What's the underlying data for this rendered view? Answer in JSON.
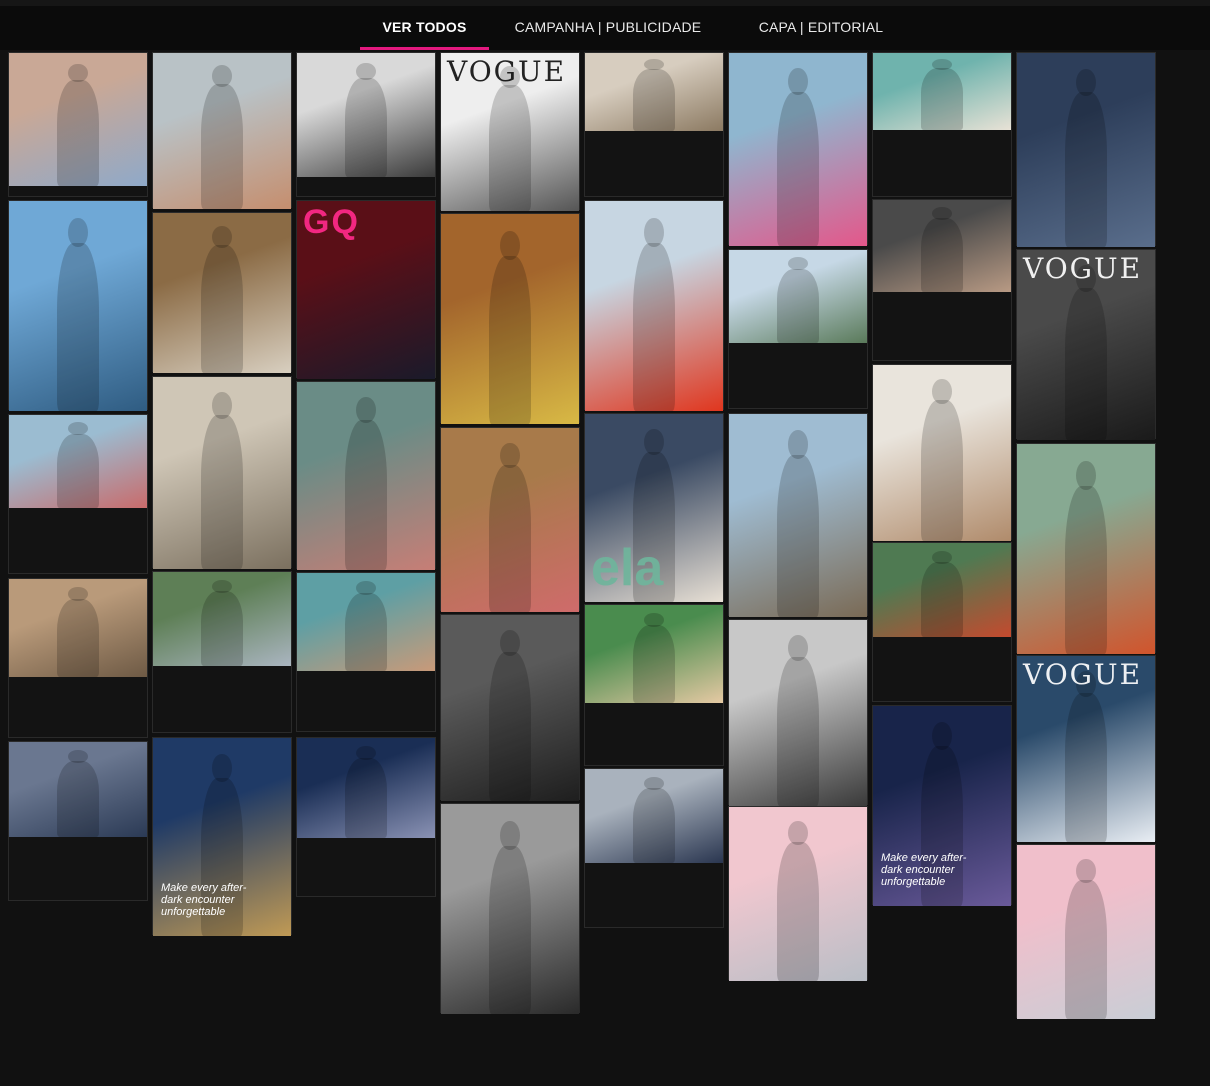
{
  "tabs": [
    {
      "label": "VER TODOS",
      "active": true
    },
    {
      "label": "CAMPANHA | PUBLICIDADE",
      "active": false
    },
    {
      "label": "CAPA | EDITORIAL",
      "active": false
    }
  ],
  "colors": {
    "accent": "#e3197f",
    "background": "#111111"
  },
  "columns": [
    [
      {
        "name": "fashion-woman-blue-blazer",
        "colors": [
          "#c9a896",
          "#8fa9c9"
        ]
      },
      {
        "name": "man-shirtless-beach",
        "colors": [
          "#6fa8d6",
          "#2f5c82"
        ]
      },
      {
        "name": "couple-picnic-beach",
        "colors": [
          "#9bbcd1",
          "#c96b6b"
        ]
      },
      {
        "name": "woman-swimsuit-lounge",
        "colors": [
          "#b99a7a",
          "#6e5a45"
        ]
      },
      {
        "name": "group-denim-campaign",
        "colors": [
          "#6a7790",
          "#2b3a55"
        ]
      }
    ],
    [
      {
        "name": "woman-red-hair-handbag",
        "colors": [
          "#b9c2c6",
          "#c58e6e"
        ]
      },
      {
        "name": "woman-straw-hat-shade",
        "colors": [
          "#8b6b45",
          "#d8cfc0"
        ]
      },
      {
        "name": "woman-white-robe-window",
        "colors": [
          "#cfc6b6",
          "#7b705f"
        ]
      },
      {
        "name": "family-denim-portrait",
        "colors": [
          "#5e7f56",
          "#aab5c0"
        ]
      },
      {
        "name": "man-suit-fragrance-ad",
        "colors": [
          "#1f3a66",
          "#c09a55"
        ],
        "tagline": "Make every after-dark encounter unforgettable"
      }
    ],
    [
      {
        "name": "man-surfboard-bw",
        "colors": [
          "#d9d9d9",
          "#3a3a3a"
        ]
      },
      {
        "name": "gq-magazine-cover",
        "colors": [
          "#5a0f17",
          "#1a1a2a"
        ],
        "mag": "GQ",
        "magClass": "gq"
      },
      {
        "name": "women-pink-dress-pool",
        "colors": [
          "#6a8c86",
          "#c77e76"
        ]
      },
      {
        "name": "woman-sunglasses-pool",
        "colors": [
          "#5e9fa4",
          "#c99a79"
        ]
      },
      {
        "name": "man-suit-fragrance-ad-small",
        "colors": [
          "#1a2e55",
          "#8a92b4"
        ]
      }
    ],
    [
      {
        "name": "vogue-rio-cover-bw",
        "colors": [
          "#eeeeee",
          "#555555"
        ],
        "mag": "VOGUE",
        "magClass": "dark"
      },
      {
        "name": "woman-yellow-dress-hut",
        "colors": [
          "#a3652c",
          "#d8b945"
        ]
      },
      {
        "name": "couple-swimwear-signs",
        "colors": [
          "#a87a4a",
          "#cf6b6b"
        ]
      },
      {
        "name": "woman-leather-jacket-bw",
        "colors": [
          "#5a5a5a",
          "#1e1e1e"
        ]
      },
      {
        "name": "couple-street-style",
        "colors": [
          "#9a9a9a",
          "#2a2a2a"
        ]
      }
    ],
    [
      {
        "name": "group-beach-white",
        "colors": [
          "#d7cdbf",
          "#8c7a62"
        ]
      },
      {
        "name": "woman-red-gown-sky",
        "colors": [
          "#c7d6e2",
          "#e0361e"
        ]
      },
      {
        "name": "ela-magazine-cover",
        "colors": [
          "#3a4a63",
          "#e8e0d5"
        ],
        "mag": "ela",
        "magClass": "ela"
      },
      {
        "name": "woman-soccer-ball",
        "colors": [
          "#4a8c4e",
          "#e5c9a3"
        ]
      },
      {
        "name": "couple-denim-stadium",
        "colors": [
          "#a9b2bd",
          "#2a3650"
        ]
      }
    ],
    [
      {
        "name": "woman-pink-surfboard",
        "colors": [
          "#8fb6cf",
          "#e4578a"
        ]
      },
      {
        "name": "woman-yoga-mountains",
        "colors": [
          "#c6d8e6",
          "#5a7a5a"
        ]
      },
      {
        "name": "couple-beach-swimwear",
        "colors": [
          "#9fbcd2",
          "#7a6a55"
        ]
      },
      {
        "name": "woman-white-blazer-bw",
        "colors": [
          "#c8c8c8",
          "#3a3a3a"
        ]
      },
      {
        "name": "woman-pink-hair-yellow-glasses",
        "colors": [
          "#f1c7cf",
          "#b9bec6"
        ]
      }
    ],
    [
      {
        "name": "woman-white-dress-teal",
        "colors": [
          "#6fb3ad",
          "#e8e2d6"
        ]
      },
      {
        "name": "woman-black-lingerie-lying",
        "colors": [
          "#4a4a4a",
          "#b89a84"
        ]
      },
      {
        "name": "woman-striped-bikini",
        "colors": [
          "#e9e4dc",
          "#b08b6b"
        ]
      },
      {
        "name": "family-red-fashion",
        "colors": [
          "#4f7a52",
          "#c44a2e"
        ]
      },
      {
        "name": "man-blue-suit-fragrance-ad",
        "colors": [
          "#18244a",
          "#6a5a9a"
        ],
        "tagline": "Make every after-dark encounter unforgettable"
      }
    ],
    [
      {
        "name": "fragrance-bottle-denim",
        "colors": [
          "#2d3e5a",
          "#5a6e8c"
        ]
      },
      {
        "name": "vogue-vozes-do-rio-cover",
        "colors": [
          "#4a4a4a",
          "#1a1a1a"
        ],
        "mag": "VOGUE",
        "magClass": ""
      },
      {
        "name": "woman-red-dress-garden",
        "colors": [
          "#87a992",
          "#d1542c"
        ]
      },
      {
        "name": "vogue-e-campea-cover",
        "colors": [
          "#2a4a6a",
          "#e9eef4"
        ],
        "mag": "VOGUE",
        "magClass": ""
      },
      {
        "name": "woman-pink-bob-silver-jacket",
        "colors": [
          "#f0bfcb",
          "#c9ced6"
        ]
      }
    ]
  ]
}
